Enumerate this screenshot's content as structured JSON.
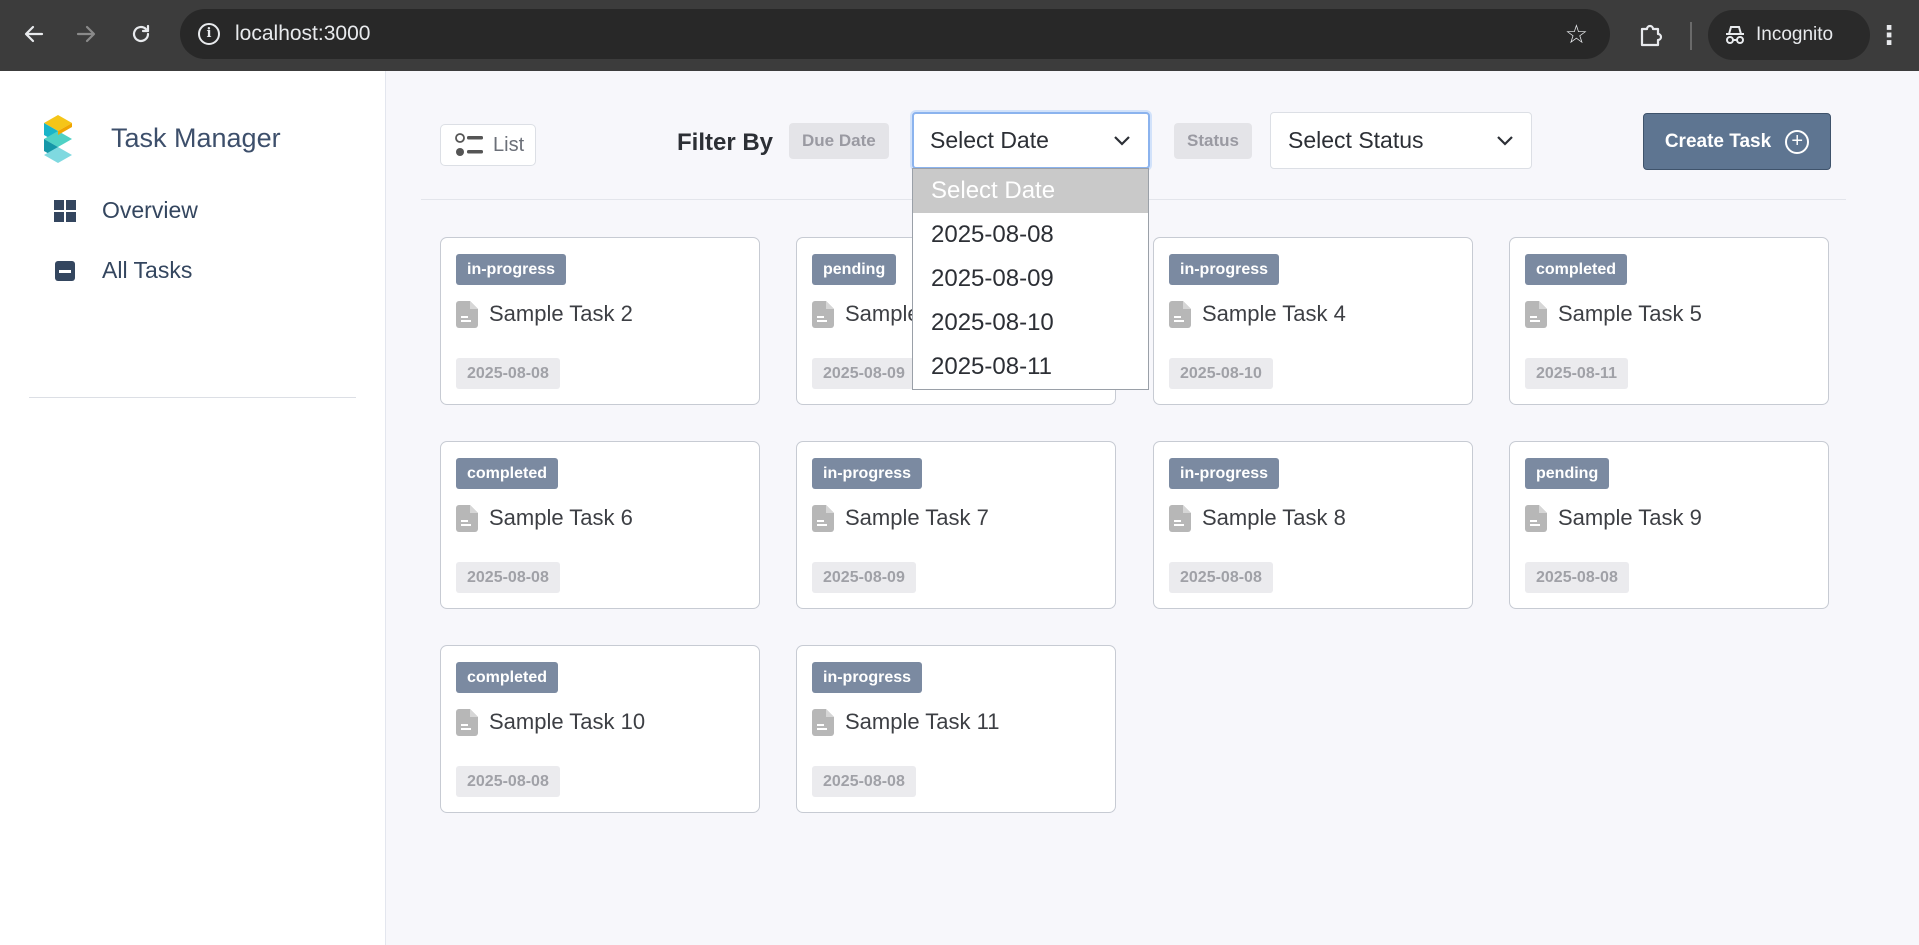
{
  "browser": {
    "url": "localhost:3000",
    "incognito_label": "Incognito"
  },
  "sidebar": {
    "app_title": "Task Manager",
    "items": [
      {
        "label": "Overview",
        "icon": "grid-icon"
      },
      {
        "label": "All Tasks",
        "icon": "minus-square-icon"
      }
    ]
  },
  "toolbar": {
    "list_label": "List",
    "filter_by": "Filter By",
    "due_date_label": "Due Date",
    "date_select_value": "Select Date",
    "status_label": "Status",
    "status_select_value": "Select Status",
    "create_label": "Create Task"
  },
  "date_dropdown": {
    "options": [
      "Select Date",
      "2025-08-08",
      "2025-08-09",
      "2025-08-10",
      "2025-08-11"
    ],
    "highlighted": "Select Date"
  },
  "tasks": [
    {
      "status": "in-progress",
      "name": "Sample Task 2",
      "date": "2025-08-08"
    },
    {
      "status": "pending",
      "name": "Sample Task 3",
      "date": "2025-08-09"
    },
    {
      "status": "in-progress",
      "name": "Sample Task 4",
      "date": "2025-08-10"
    },
    {
      "status": "completed",
      "name": "Sample Task 5",
      "date": "2025-08-11"
    },
    {
      "status": "completed",
      "name": "Sample Task 6",
      "date": "2025-08-08"
    },
    {
      "status": "in-progress",
      "name": "Sample Task 7",
      "date": "2025-08-09"
    },
    {
      "status": "in-progress",
      "name": "Sample Task 8",
      "date": "2025-08-08"
    },
    {
      "status": "pending",
      "name": "Sample Task 9",
      "date": "2025-08-08"
    },
    {
      "status": "completed",
      "name": "Sample Task 10",
      "date": "2025-08-08"
    },
    {
      "status": "in-progress",
      "name": "Sample Task 11",
      "date": "2025-08-08"
    }
  ],
  "colors": {
    "accent": "#5e7591",
    "status_badge": "#7b8aa1",
    "sidebar_text": "#34465f"
  }
}
